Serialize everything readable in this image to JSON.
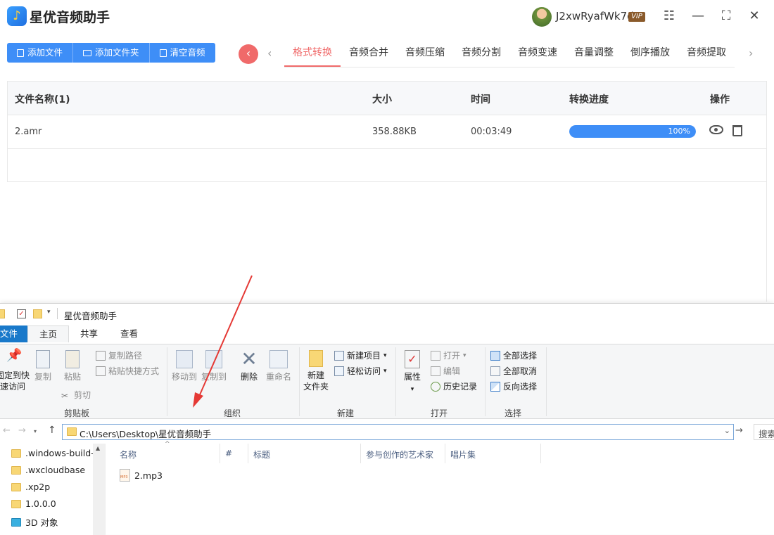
{
  "app": {
    "title": "星优音频助手",
    "user_name": "J2xwRyafWk7d",
    "vip_label": "VIP",
    "window_controls": {
      "settings": "☷",
      "minimize": "—",
      "maximize": "⛶",
      "close": "✕"
    }
  },
  "toolbar": {
    "add_file": "添加文件",
    "add_folder": "添加文件夹",
    "clear_audio": "清空音频"
  },
  "tabs": [
    {
      "label": "格式转换",
      "active": true
    },
    {
      "label": "音频合并"
    },
    {
      "label": "音频压缩"
    },
    {
      "label": "音频分割"
    },
    {
      "label": "音频变速"
    },
    {
      "label": "音量调整"
    },
    {
      "label": "倒序播放"
    },
    {
      "label": "音频提取"
    }
  ],
  "table": {
    "headers": {
      "name": "文件名称(1)",
      "size": "大小",
      "time": "时间",
      "progress": "转换进度",
      "ops": "操作"
    },
    "rows": [
      {
        "name": "2.amr",
        "size": "358.88KB",
        "time": "00:03:49",
        "progress": 100,
        "progress_text": "100%"
      }
    ]
  },
  "explorer": {
    "title": "星优音频助手",
    "ribbon_tabs": [
      "文件",
      "主页",
      "共享",
      "查看"
    ],
    "clipboard": {
      "pin": "固定到快速访问",
      "pin_line1": "固定到快",
      "pin_line2": "速访问",
      "copy": "复制",
      "paste": "粘贴",
      "copy_path": "复制路径",
      "paste_shortcut": "粘贴快捷方式",
      "cut": "剪切",
      "label": "剪贴板"
    },
    "organize": {
      "move_to": "移动到",
      "copy_to": "复制到",
      "delete": "删除",
      "rename": "重命名",
      "label": "组织"
    },
    "new": {
      "new_folder_line1": "新建",
      "new_folder_line2": "文件夹",
      "new_item": "新建项目",
      "easy_access": "轻松访问",
      "label": "新建"
    },
    "open": {
      "properties": "属性",
      "open": "打开",
      "edit": "编辑",
      "history": "历史记录",
      "label": "打开"
    },
    "select": {
      "select_all": "全部选择",
      "select_none": "全部取消",
      "invert": "反向选择",
      "label": "选择"
    },
    "address": "C:\\Users\\Desktop\\星优音频助手",
    "search_placeholder": "搜索",
    "nav_items": [
      ".windows-build-t",
      ".wxcloudbase",
      ".xp2p",
      "1.0.0.0",
      "3D 对象"
    ],
    "columns": [
      "名称",
      "#",
      "标题",
      "参与创作的艺术家",
      "唱片集"
    ],
    "files": [
      {
        "name": "2.mp3"
      }
    ]
  },
  "colors": {
    "accent": "#3e8ef7",
    "tab_active": "#f06a6a",
    "annotation_arrow": "#e53935"
  }
}
